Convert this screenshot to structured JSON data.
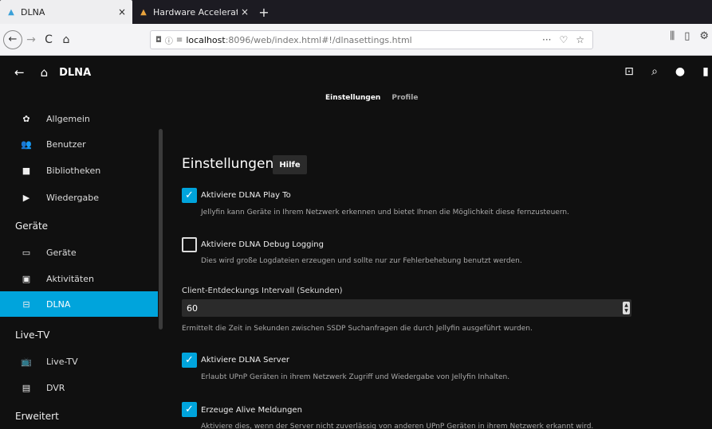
{
  "browser": {
    "tabs": [
      {
        "title": "DLNA",
        "active": true
      },
      {
        "title": "Hardware Acceleration |",
        "active": false
      }
    ],
    "new_tab_symbol": "+",
    "close_symbol": "×",
    "url_host": "localhost",
    "url_path": ":8096/web/index.html#!/dlnasettings.html",
    "url_more": "···"
  },
  "header": {
    "title": "DLNA",
    "icons": [
      "back-arrow-icon",
      "home-icon",
      "cast-icon",
      "search-icon",
      "user-icon"
    ]
  },
  "subtabs": [
    {
      "label": "Einstellungen",
      "active": true
    },
    {
      "label": "Profile",
      "active": false
    }
  ],
  "sidebar": {
    "items": [
      {
        "label": "Allgemein",
        "icon": "gear-icon"
      },
      {
        "label": "Benutzer",
        "icon": "users-icon"
      },
      {
        "label": "Bibliotheken",
        "icon": "folder-icon"
      },
      {
        "label": "Wiedergabe",
        "icon": "play-icon"
      }
    ],
    "sections": [
      "Geräte",
      "Live-TV",
      "Erweitert"
    ],
    "devices_items": [
      {
        "label": "Geräte",
        "icon": "devices-icon"
      },
      {
        "label": "Aktivitäten",
        "icon": "activity-icon"
      },
      {
        "label": "DLNA",
        "icon": "dlna-icon",
        "active": true
      }
    ],
    "livetv_items": [
      {
        "label": "Live-TV",
        "icon": "tv-icon"
      },
      {
        "label": "DVR",
        "icon": "dvr-icon"
      }
    ]
  },
  "main": {
    "heading": "Einstellungen",
    "help_label": "Hilfe",
    "options": [
      {
        "label": "Aktiviere DLNA Play To",
        "checked": true,
        "desc": "Jellyfin kann Geräte in Ihrem Netzwerk erkennen und bietet Ihnen die Möglichkeit diese fernzusteuern."
      },
      {
        "label": "Aktiviere DLNA Debug Logging",
        "checked": false,
        "desc": "Dies wird große Logdateien erzeugen und sollte nur zur Fehlerbehebung benutzt werden."
      },
      {
        "label": "Aktiviere DLNA Server",
        "checked": true,
        "desc": "Erlaubt UPnP Geräten in ihrem Netzwerk Zugriff und Wiedergabe von Jellyfin Inhalten."
      },
      {
        "label": "Erzeuge Alive Meldungen",
        "checked": true,
        "desc": "Aktiviere dies, wenn der Server nicht zuverlässig von anderen UPnP Geräten in ihrem Netzwerk erkannt wird."
      }
    ],
    "interval_label": "Client-Entdeckungs Intervall (Sekunden)",
    "interval_value": "60",
    "interval_desc": "Ermittelt die Zeit in Sekunden zwischen SSDP Suchanfragen die durch Jellyfin ausgeführt wurden."
  },
  "colors": {
    "accent": "#00a4dc",
    "background": "#101010"
  }
}
